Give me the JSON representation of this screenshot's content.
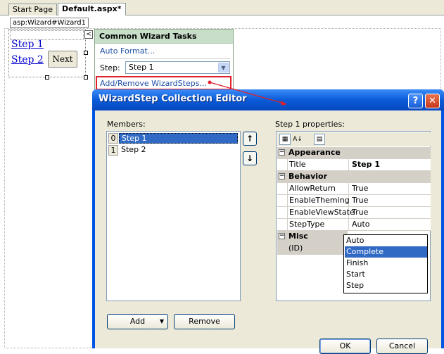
{
  "tabs": [
    {
      "label": "Start Page",
      "active": false
    },
    {
      "label": "Default.aspx*",
      "active": true
    }
  ],
  "control": {
    "label": "asp:Wizard#Wizard1",
    "step_links": [
      "Step 1",
      "Step 2"
    ],
    "next_label": "Next"
  },
  "smart_tag": {
    "title": "Common Wizard Tasks",
    "auto_format": "Auto Format...",
    "step_label": "Step:",
    "step_value": "Step 1",
    "add_remove": "Add/Remove WizardSteps..."
  },
  "dialog": {
    "title": "WizardStep Collection Editor",
    "members_label": "Members:",
    "members": [
      {
        "index": "0",
        "name": "Step 1",
        "selected": true
      },
      {
        "index": "1",
        "name": "Step 2",
        "selected": false
      }
    ],
    "add_label": "Add",
    "remove_label": "Remove",
    "properties_label": "Step 1 properties:",
    "categories": {
      "appearance": "Appearance",
      "behavior": "Behavior",
      "misc": "Misc"
    },
    "properties": {
      "title": {
        "name": "Title",
        "value": "Step 1"
      },
      "allow_return": {
        "name": "AllowReturn",
        "value": "True"
      },
      "enable_theming": {
        "name": "EnableTheming",
        "value": "True"
      },
      "enable_viewstate": {
        "name": "EnableViewState",
        "value": "True"
      },
      "step_type": {
        "name": "StepType",
        "value": "Auto"
      },
      "id": {
        "name": "(ID)",
        "value": ""
      }
    },
    "steptype_options": [
      "Auto",
      "Complete",
      "Finish",
      "Start",
      "Step"
    ],
    "steptype_highlighted": "Complete",
    "ok_label": "OK",
    "cancel_label": "Cancel",
    "help_glyph": "?",
    "close_glyph": "✕"
  },
  "colors": {
    "title_bar": "#0a5bd8",
    "highlight": "#316ac5",
    "annotation_red": "#e0202a"
  }
}
